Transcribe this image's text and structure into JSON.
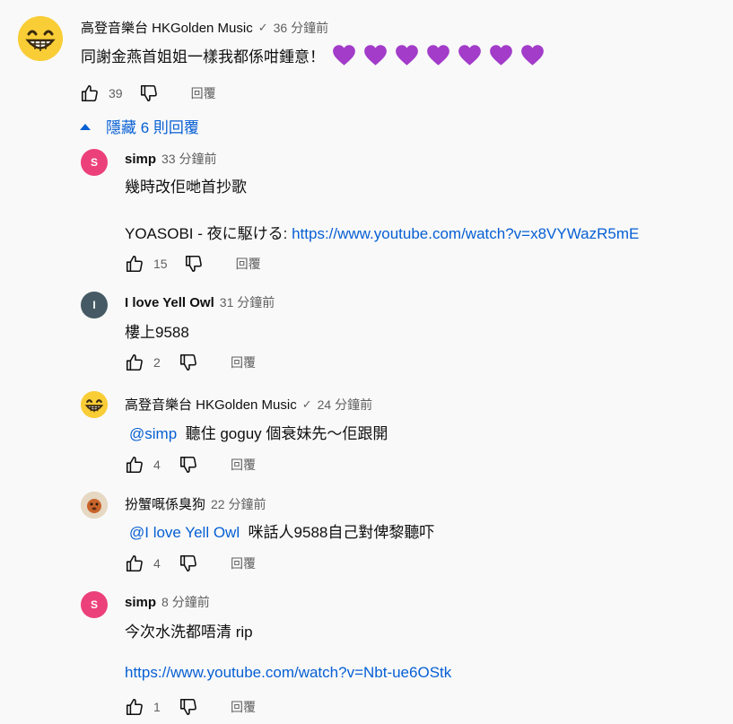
{
  "top_comment": {
    "author": "高登音樂台 HKGolden Music",
    "verified": "✓",
    "time": "36 分鐘前",
    "text": "同謝金燕首姐姐一樣我都係咁鍾意！",
    "likes": "39",
    "reply_label": "回覆",
    "heart_count": 7,
    "heart_color": "#a23cc9"
  },
  "replies_toggle": {
    "label": "隱藏 6 則回覆"
  },
  "replies": [
    {
      "author": "simp",
      "time": "33 分鐘前",
      "line1": "幾時改佢哋首抄歌",
      "line2_prefix": "YOASOBI - 夜に駆ける: ",
      "line2_link": "https://www.youtube.com/watch?v=x8VYWazR5mE",
      "likes": "15",
      "reply_label": "回覆",
      "avatar_letter": "S",
      "avatar_color": "#ec407a"
    },
    {
      "author": "I love Yell Owl",
      "time": "31 分鐘前",
      "line1": "樓上9588",
      "likes": "2",
      "reply_label": "回覆",
      "avatar_letter": "I",
      "avatar_color": "#455a64"
    },
    {
      "author": "高登音樂台 HKGolden Music",
      "verified": "✓",
      "time": "24 分鐘前",
      "mention": "@simp",
      "line1": "聽住 goguy 個衰妹先～佢跟開",
      "likes": "4",
      "reply_label": "回覆"
    },
    {
      "author": "扮蟹嘅係臭狗",
      "time": "22 分鐘前",
      "mention": "@I love Yell Owl",
      "line1": "咪話人9588自己對俾黎聽吓",
      "likes": "4",
      "reply_label": "回覆"
    },
    {
      "author": "simp",
      "time": "8 分鐘前",
      "line1": "今次水洗都唔清 rip",
      "line2_link": "https://www.youtube.com/watch?v=Nbt-ue6OStk",
      "likes": "1",
      "reply_label": "回覆",
      "avatar_letter": "S",
      "avatar_color": "#ec407a"
    }
  ]
}
